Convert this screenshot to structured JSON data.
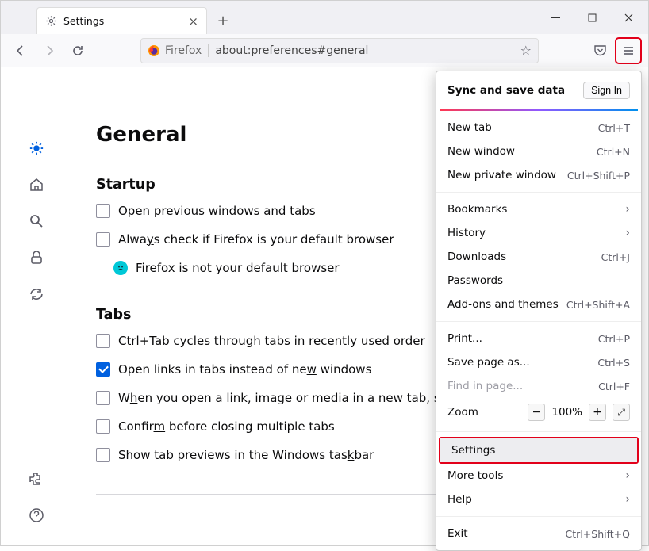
{
  "tab": {
    "title": "Settings"
  },
  "urlbar": {
    "brand": "Firefox",
    "address": "about:preferences#general"
  },
  "page": {
    "title": "General",
    "startup": {
      "heading": "Startup",
      "restore": {
        "pre": "Open previo",
        "u": "u",
        "post": "s windows and tabs"
      },
      "default_check": {
        "pre": "Alwa",
        "u": "y",
        "post": "s check if Firefox is your default browser"
      },
      "default_msg": "Firefox is not your default browser"
    },
    "tabs": {
      "heading": "Tabs",
      "cycle": {
        "pre": "Ctrl+",
        "u": "T",
        "post": "ab cycles through tabs in recently used order"
      },
      "openlinks": {
        "pre": "Open links in tabs instead of ne",
        "u": "w",
        "post": " windows"
      },
      "switch": {
        "pre": "W",
        "u": "h",
        "post": "en you open a link, image or media in a new tab, switch t"
      },
      "confirm": {
        "pre": "Confir",
        "u": "m",
        "post": " before closing multiple tabs"
      },
      "taskbar": {
        "pre": "Show tab previews in the Windows tas",
        "u": "k",
        "post": "bar"
      }
    }
  },
  "menu": {
    "sync_heading": "Sync and save data",
    "sign_in": "Sign In",
    "new_tab": "New tab",
    "new_tab_s": "Ctrl+T",
    "new_window": "New window",
    "new_window_s": "Ctrl+N",
    "new_private": "New private window",
    "new_private_s": "Ctrl+Shift+P",
    "bookmarks": "Bookmarks",
    "history": "History",
    "downloads": "Downloads",
    "downloads_s": "Ctrl+J",
    "passwords": "Passwords",
    "addons": "Add-ons and themes",
    "addons_s": "Ctrl+Shift+A",
    "print": "Print...",
    "print_s": "Ctrl+P",
    "save_as": "Save page as...",
    "save_as_s": "Ctrl+S",
    "find": "Find in page...",
    "find_s": "Ctrl+F",
    "zoom": "Zoom",
    "zoom_pct": "100%",
    "settings": "Settings",
    "more_tools": "More tools",
    "help": "Help",
    "exit": "Exit",
    "exit_s": "Ctrl+Shift+Q"
  }
}
